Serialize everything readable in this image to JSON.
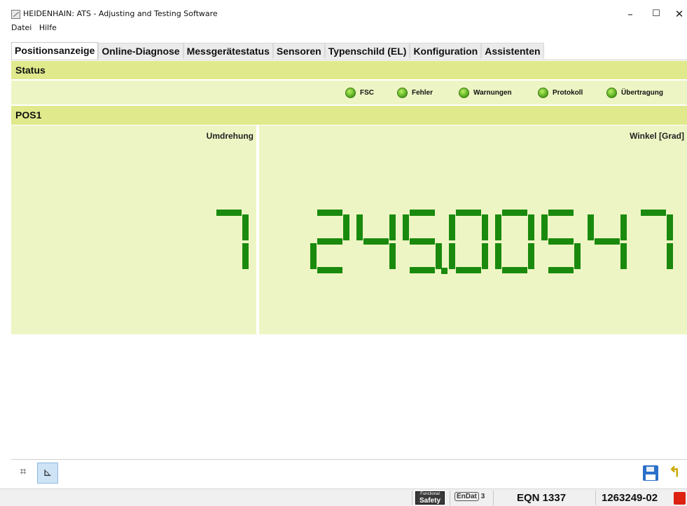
{
  "window": {
    "title": "HEIDENHAIN: ATS - Adjusting and Testing Software",
    "controls": {
      "minimize": "–",
      "maximize": "☐",
      "close": "✕"
    }
  },
  "menu": [
    "Datei",
    "Hilfe"
  ],
  "tabs": [
    {
      "label": "Positionsanzeige",
      "active": true
    },
    {
      "label": "Online-Diagnose",
      "active": false
    },
    {
      "label": "Messgerätestatus",
      "active": false
    },
    {
      "label": "Sensoren",
      "active": false
    },
    {
      "label": "Typenschild (EL)",
      "active": false
    },
    {
      "label": "Konfiguration",
      "active": false
    },
    {
      "label": "Assistenten",
      "active": false
    }
  ],
  "status": {
    "heading": "Status",
    "indicators": [
      {
        "label": "FSC",
        "state": "ok",
        "color": "#4da31a"
      },
      {
        "label": "Fehler",
        "state": "ok",
        "color": "#4da31a"
      },
      {
        "label": "Warnungen",
        "state": "ok",
        "color": "#4da31a"
      },
      {
        "label": "Protokoll",
        "state": "ok",
        "color": "#4da31a"
      },
      {
        "label": "Übertragung",
        "state": "ok",
        "color": "#4da31a"
      }
    ]
  },
  "position": {
    "heading": "POS1",
    "revolutions": {
      "label": "Umdrehung",
      "value": "7"
    },
    "angle": {
      "label": "Winkel [Grad]",
      "value": "245.00547"
    },
    "digit_color": "#1a8a0e"
  },
  "toolbar": {
    "grid_icon": "grid-icon",
    "axis_icon": "axis-icon",
    "save_icon": "save-icon",
    "exit_icon": "exit-icon"
  },
  "statusbar": {
    "functional_safety": {
      "line1": "Functional",
      "line2": "Safety"
    },
    "endat": {
      "text": "EnDat",
      "version": "3"
    },
    "device": "EQN 1337",
    "serial": "1263249-02"
  },
  "colors": {
    "band": "#e0ea8c",
    "panel_bg": "#eef5c4",
    "led": "#4da31a"
  }
}
